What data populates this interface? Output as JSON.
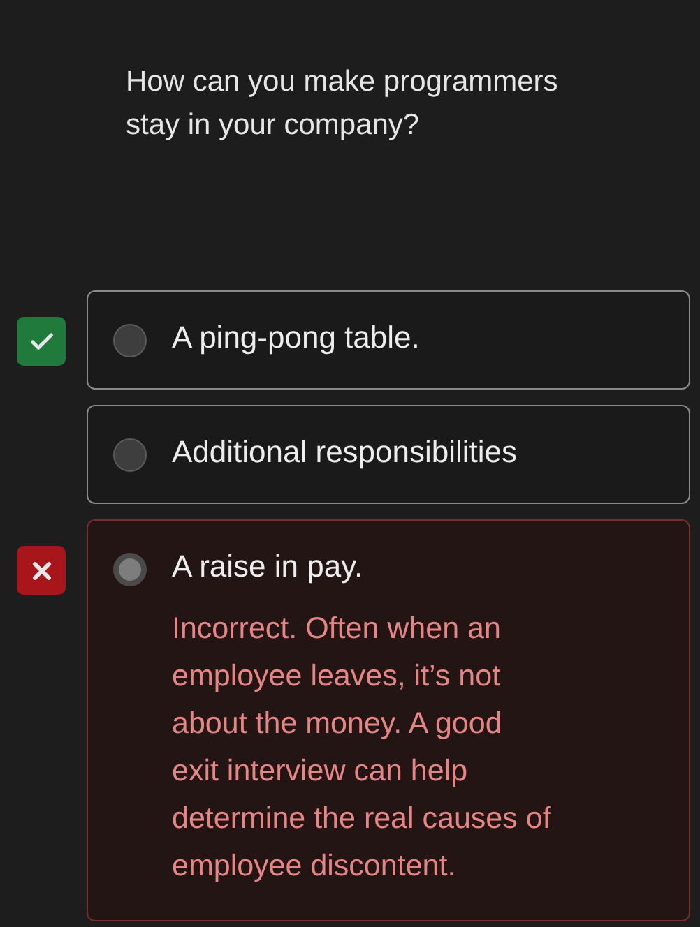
{
  "question": "How can you make programmers stay in your company?",
  "options": [
    {
      "kind": "correct",
      "label": "A ping-pong table.",
      "selected": false
    },
    {
      "kind": "plain",
      "label": "Additional responsibilities",
      "selected": false
    },
    {
      "kind": "incorrect",
      "label": "A raise in pay.",
      "selected": true,
      "feedback": "Incorrect. Often when an employee leaves, it’s not about the money. A good exit interview can help determine the real causes of employee discontent."
    }
  ]
}
